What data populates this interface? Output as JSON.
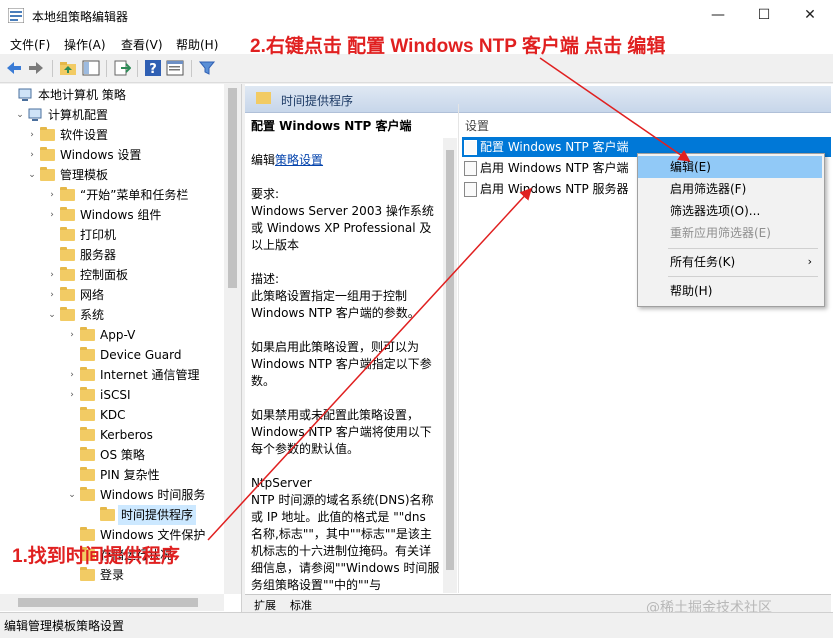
{
  "window": {
    "title": "本地组策略编辑器",
    "min_glyph": "—",
    "max_glyph": "☐",
    "close_glyph": "✕"
  },
  "menu": [
    "文件(F)",
    "操作(A)",
    "查看(V)",
    "帮助(H)"
  ],
  "annotations": {
    "step2": "2.右键点击 配置 Windows NTP 客户端 点击 编辑",
    "step1": "1.找到时间提供程序"
  },
  "toolbar": {
    "icons": [
      "back-icon",
      "forward-icon",
      "up-folder-icon",
      "show-hide-tree-icon",
      "export-list-icon",
      "help-icon",
      "properties-icon",
      "filter-icon"
    ]
  },
  "tree": {
    "items": [
      {
        "label": "本地计算机 策略",
        "level": 0,
        "expand": "",
        "icon": "computer"
      },
      {
        "label": "计算机配置",
        "level": 1,
        "expand": "v",
        "icon": "computer"
      },
      {
        "label": "软件设置",
        "level": 2,
        "expand": ">",
        "icon": "folder"
      },
      {
        "label": "Windows 设置",
        "level": 2,
        "expand": ">",
        "icon": "folder"
      },
      {
        "label": "管理模板",
        "level": 2,
        "expand": "v",
        "icon": "folder"
      },
      {
        "label": "“开始”菜单和任务栏",
        "level": 3,
        "expand": ">",
        "icon": "folder"
      },
      {
        "label": "Windows 组件",
        "level": 3,
        "expand": ">",
        "icon": "folder"
      },
      {
        "label": "打印机",
        "level": 3,
        "expand": "",
        "icon": "folder"
      },
      {
        "label": "服务器",
        "level": 3,
        "expand": "",
        "icon": "folder"
      },
      {
        "label": "控制面板",
        "level": 3,
        "expand": ">",
        "icon": "folder"
      },
      {
        "label": "网络",
        "level": 3,
        "expand": ">",
        "icon": "folder"
      },
      {
        "label": "系统",
        "level": 3,
        "expand": "v",
        "icon": "folder"
      },
      {
        "label": "App-V",
        "level": 4,
        "expand": ">",
        "icon": "folder"
      },
      {
        "label": "Device Guard",
        "level": 4,
        "expand": "",
        "icon": "folder"
      },
      {
        "label": "Internet 通信管理",
        "level": 4,
        "expand": ">",
        "icon": "folder"
      },
      {
        "label": "iSCSI",
        "level": 4,
        "expand": ">",
        "icon": "folder"
      },
      {
        "label": "KDC",
        "level": 4,
        "expand": "",
        "icon": "folder"
      },
      {
        "label": "Kerberos",
        "level": 4,
        "expand": "",
        "icon": "folder"
      },
      {
        "label": "OS 策略",
        "level": 4,
        "expand": "",
        "icon": "folder"
      },
      {
        "label": "PIN 复杂性",
        "level": 4,
        "expand": "",
        "icon": "folder"
      },
      {
        "label": "Windows 时间服务",
        "level": 4,
        "expand": "v",
        "icon": "folder"
      },
      {
        "label": "时间提供程序",
        "level": 5,
        "expand": "",
        "icon": "folder",
        "selected": true
      },
      {
        "label": "Windows 文件保护",
        "level": 4,
        "expand": "",
        "icon": "folder"
      },
      {
        "label": "存储运行状况",
        "level": 4,
        "expand": "",
        "icon": "folder"
      },
      {
        "label": "登录",
        "level": 4,
        "expand": "",
        "icon": "folder"
      }
    ]
  },
  "right_header": "时间提供程序",
  "description": {
    "title": "配置 Windows NTP 客户端",
    "edit_prefix": "编辑",
    "edit_link": "策略设置",
    "requirements": "要求:\nWindows Server 2003 操作系统或 Windows XP Professional 及以上版本",
    "desc": "描述:\n此策略设置指定一组用于控制 Windows NTP 客户端的参数。",
    "enabled": "如果启用此策略设置，则可以为 Windows NTP 客户端指定以下参数。",
    "disabled": "如果禁用或未配置此策略设置，Windows NTP 客户端将使用以下每个参数的默认值。",
    "ntpserver": "NtpServer\nNTP 时间源的域名系统(DNS)名称或 IP 地址。此值的格式是 \"\"dns 名称,标志\"\"，其中\"\"标志\"\"是该主机标志的十六进制位掩码。有关详细信息，请参阅\"\"Windows 时间服务组策略设置\"\"中的\"\"与"
  },
  "settings": {
    "column": "设置",
    "rows": [
      {
        "label": "配置 Windows NTP 客户端",
        "selected": true
      },
      {
        "label": "启用 Windows NTP 客户端",
        "selected": false
      },
      {
        "label": "启用 Windows NTP 服务器",
        "selected": false
      }
    ]
  },
  "context_menu": {
    "items": [
      {
        "label": "编辑(E)",
        "state": "highlighted"
      },
      {
        "label": "启用筛选器(F)",
        "state": "normal"
      },
      {
        "label": "筛选器选项(O)...",
        "state": "normal"
      },
      {
        "label": "重新应用筛选器(E)",
        "state": "disabled"
      },
      {
        "label": "所有任务(K)",
        "state": "submenu"
      },
      {
        "label": "帮助(H)",
        "state": "normal"
      }
    ]
  },
  "tabs": [
    "扩展",
    "标准"
  ],
  "watermark": "@稀土掘金技术社区",
  "status_bar": "编辑管理模板策略设置",
  "colors": {
    "selection": "#0078d7",
    "tree_selection": "#cce8ff",
    "menu_highlight": "#91c9f7",
    "annotation": "#e02020",
    "folder": "#f2cb64"
  }
}
